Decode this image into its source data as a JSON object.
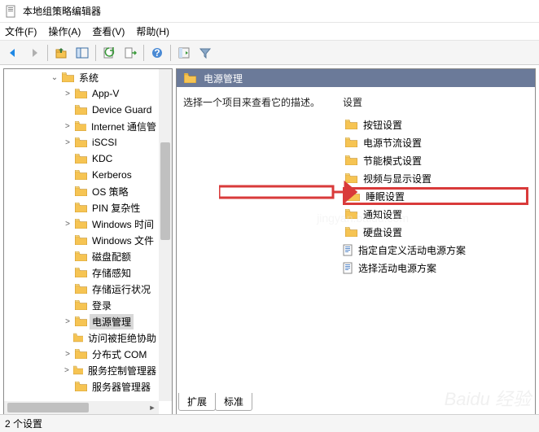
{
  "window": {
    "title": "本地组策略编辑器"
  },
  "menu": {
    "file": "文件(F)",
    "action": "操作(A)",
    "view": "查看(V)",
    "help": "帮助(H)"
  },
  "tree": {
    "root": {
      "label": "系统",
      "expanded": true
    },
    "children": [
      {
        "label": "App-V",
        "exp": ">"
      },
      {
        "label": "Device Guard",
        "exp": ""
      },
      {
        "label": "Internet 通信管",
        "exp": ">"
      },
      {
        "label": "iSCSI",
        "exp": ">"
      },
      {
        "label": "KDC",
        "exp": ""
      },
      {
        "label": "Kerberos",
        "exp": ""
      },
      {
        "label": "OS 策略",
        "exp": ""
      },
      {
        "label": "PIN 复杂性",
        "exp": ""
      },
      {
        "label": "Windows 时间",
        "exp": ">"
      },
      {
        "label": "Windows 文件",
        "exp": ""
      },
      {
        "label": "磁盘配额",
        "exp": ""
      },
      {
        "label": "存储感知",
        "exp": ""
      },
      {
        "label": "存储运行状况",
        "exp": ""
      },
      {
        "label": "登录",
        "exp": ""
      },
      {
        "label": "电源管理",
        "exp": ">",
        "selected": true
      },
      {
        "label": "访问被拒绝协助",
        "exp": ""
      },
      {
        "label": "分布式 COM",
        "exp": ">"
      },
      {
        "label": "服务控制管理器",
        "exp": ">"
      },
      {
        "label": "服务器管理器",
        "exp": ""
      }
    ]
  },
  "right": {
    "header": "电源管理",
    "desc": "选择一个项目来查看它的描述。",
    "settings_label": "设置",
    "items": [
      {
        "type": "folder",
        "label": "按钮设置"
      },
      {
        "type": "folder",
        "label": "电源节流设置"
      },
      {
        "type": "folder",
        "label": "节能模式设置"
      },
      {
        "type": "folder",
        "label": "视频与显示设置"
      },
      {
        "type": "folder",
        "label": "睡眠设置",
        "highlight": true
      },
      {
        "type": "folder",
        "label": "通知设置"
      },
      {
        "type": "folder",
        "label": "硬盘设置"
      },
      {
        "type": "policy",
        "label": "指定自定义活动电源方案"
      },
      {
        "type": "policy",
        "label": "选择活动电源方案"
      }
    ]
  },
  "tabs": {
    "extended": "扩展",
    "standard": "标准"
  },
  "status": {
    "text": "2 个设置"
  },
  "watermark": "Baidu 经验"
}
